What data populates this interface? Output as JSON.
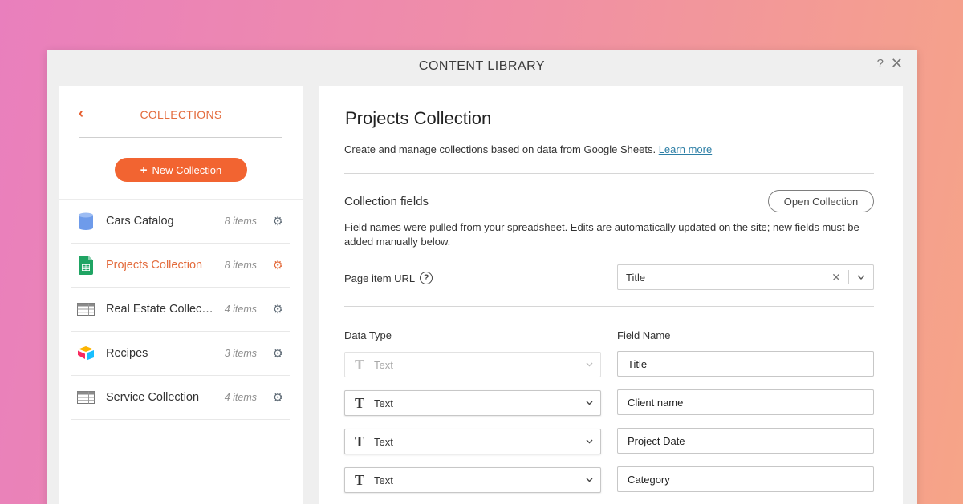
{
  "window": {
    "title": "CONTENT LIBRARY",
    "help_label": "?",
    "close_label": "✕"
  },
  "sidebar": {
    "back_icon": "chevron-left-icon",
    "back_label": "‹",
    "title": "COLLECTIONS",
    "new_button": {
      "icon": "+",
      "label": "New Collection"
    },
    "collections": [
      {
        "name": "Cars Catalog",
        "count": "8 items",
        "icon": "database-icon",
        "active": false
      },
      {
        "name": "Projects Collection",
        "count": "8 items",
        "icon": "google-sheets-icon",
        "active": true
      },
      {
        "name": "Real Estate Collec…",
        "count": "4 items",
        "icon": "table-icon",
        "active": false
      },
      {
        "name": "Recipes",
        "count": "3 items",
        "icon": "airtable-icon",
        "active": false
      },
      {
        "name": "Service Collection",
        "count": "4 items",
        "icon": "table-icon",
        "active": false
      }
    ]
  },
  "main": {
    "title": "Projects Collection",
    "description": "Create and manage collections based on data from Google Sheets.",
    "learn_more": "Learn more",
    "fields_section": {
      "title": "Collection fields",
      "open_button": "Open Collection",
      "description": "Field names were pulled from your spreadsheet. Edits are automatically updated on the site; new fields must be added manually below."
    },
    "page_item_url": {
      "label": "Page item URL",
      "help": "?",
      "value": "Title",
      "clear": "✕",
      "chevron": "⌄"
    },
    "columns": {
      "data_type": "Data Type",
      "field_name": "Field Name"
    },
    "fields": [
      {
        "type_glyph": "T",
        "type": "Text",
        "name": "Title",
        "disabled": true
      },
      {
        "type_glyph": "T",
        "type": "Text",
        "name": "Client name",
        "disabled": false
      },
      {
        "type_glyph": "T",
        "type": "Text",
        "name": "Project Date",
        "disabled": false
      },
      {
        "type_glyph": "T",
        "type": "Text",
        "name": "Category",
        "disabled": false
      }
    ]
  },
  "colors": {
    "accent": "#f26431",
    "accent_text": "#e36b3c",
    "link": "#2d7fa6"
  }
}
